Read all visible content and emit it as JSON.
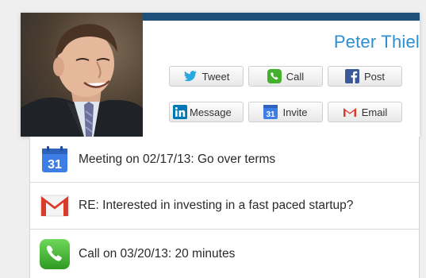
{
  "profile": {
    "name": "Peter Thiel",
    "photo_alt": "profile photo"
  },
  "actions": {
    "tweet": "Tweet",
    "call": "Call",
    "post": "Post",
    "message": "Message",
    "invite": "Invite",
    "email": "Email"
  },
  "icons": {
    "twitter": "twitter-bird-icon",
    "phone": "phone-icon",
    "facebook": "facebook-f-icon",
    "linkedin": "linkedin-in-icon",
    "calendar": "calendar-31-icon",
    "gmail": "gmail-m-icon"
  },
  "activity": [
    {
      "icon": "calendar-31-icon",
      "text": "Meeting on 02/17/13: Go over terms"
    },
    {
      "icon": "gmail-m-icon",
      "text": "RE: Interested in investing in a fast paced startup?"
    },
    {
      "icon": "phone-icon",
      "text": "Call on 03/20/13: 20 minutes"
    }
  ],
  "colors": {
    "header_bar": "#1d4f78",
    "name": "#2b8fd1",
    "twitter": "#2aa9e0",
    "facebook": "#3b5998",
    "linkedin": "#0077b5",
    "calendar": "#3d7ee6",
    "gmail_red": "#d93b2b",
    "phone_green": "#43b12e"
  },
  "calendar_number": "31"
}
